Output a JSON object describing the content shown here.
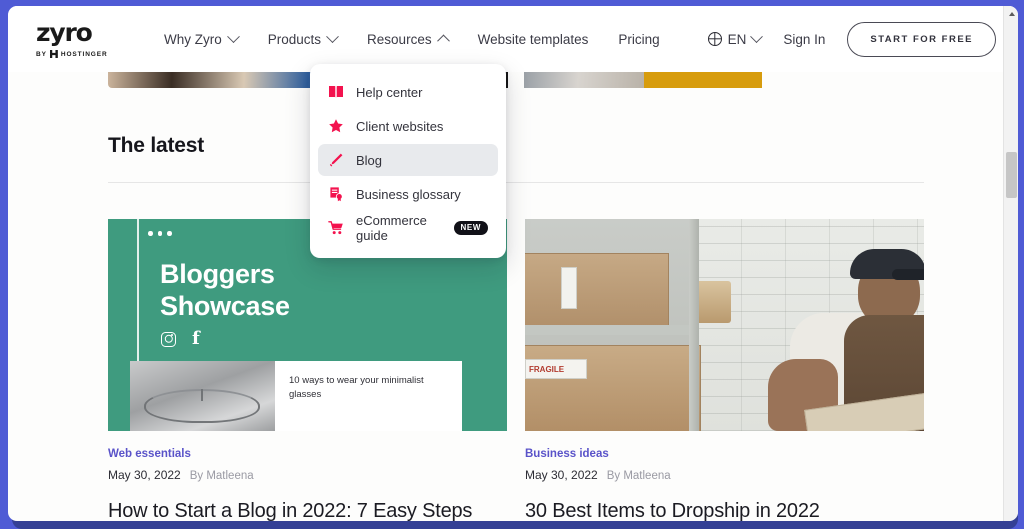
{
  "header": {
    "logo": {
      "word": "zyro",
      "by": "BY",
      "parent": "HOSTINGER"
    },
    "nav": [
      {
        "label": "Why Zyro",
        "caret": "down"
      },
      {
        "label": "Products",
        "caret": "down"
      },
      {
        "label": "Resources",
        "caret": "up"
      },
      {
        "label": "Website templates",
        "caret": "none"
      },
      {
        "label": "Pricing",
        "caret": "none"
      }
    ],
    "language": "EN",
    "sign_in": "Sign In",
    "cta": "START FOR FREE"
  },
  "dropdown": {
    "open_for": "Resources",
    "items": [
      {
        "label": "Help center",
        "icon": "book-icon",
        "active": false,
        "badge": ""
      },
      {
        "label": "Client websites",
        "icon": "star-icon",
        "active": false,
        "badge": ""
      },
      {
        "label": "Blog",
        "icon": "pencil-icon",
        "active": true,
        "badge": ""
      },
      {
        "label": "Business glossary",
        "icon": "document-seal-icon",
        "active": false,
        "badge": ""
      },
      {
        "label": "eCommerce guide",
        "icon": "shopping-cart-icon",
        "active": false,
        "badge": "NEW"
      }
    ],
    "icon_color": "#f3124e",
    "active_bg": "#e8eaed"
  },
  "main": {
    "section_title": "The latest",
    "articles": [
      {
        "category": "Web essentials",
        "date": "May 30, 2022",
        "author": "By Matleena",
        "title": "How to Start a Blog in 2022: 7 Easy Steps",
        "thumb": {
          "kind": "graphic",
          "heading_line1": "Bloggers",
          "heading_line2": "Showcase",
          "social": [
            "instagram-icon",
            "facebook-icon"
          ],
          "inset_caption": "10 ways to wear your minimalist glasses",
          "background": "#3f9b7f"
        }
      },
      {
        "category": "Business ideas",
        "date": "May 30, 2022",
        "author": "By Matleena",
        "title": "30 Best Items to Dropship in 2022",
        "thumb": {
          "kind": "photo",
          "description": "Man in cap and vest packing cardboard boxes in a warehouse with a white brick wall",
          "box_label": "FRAGILE"
        }
      }
    ]
  },
  "colors": {
    "frame": "#4f5bd5",
    "page_bg": "#fdfdfc",
    "accent_pink": "#f3124e",
    "category_purple": "#5a53c9",
    "badge_bg": "#111118"
  },
  "scrollbar": {
    "position": "right",
    "thumb_top_pct": 28
  }
}
